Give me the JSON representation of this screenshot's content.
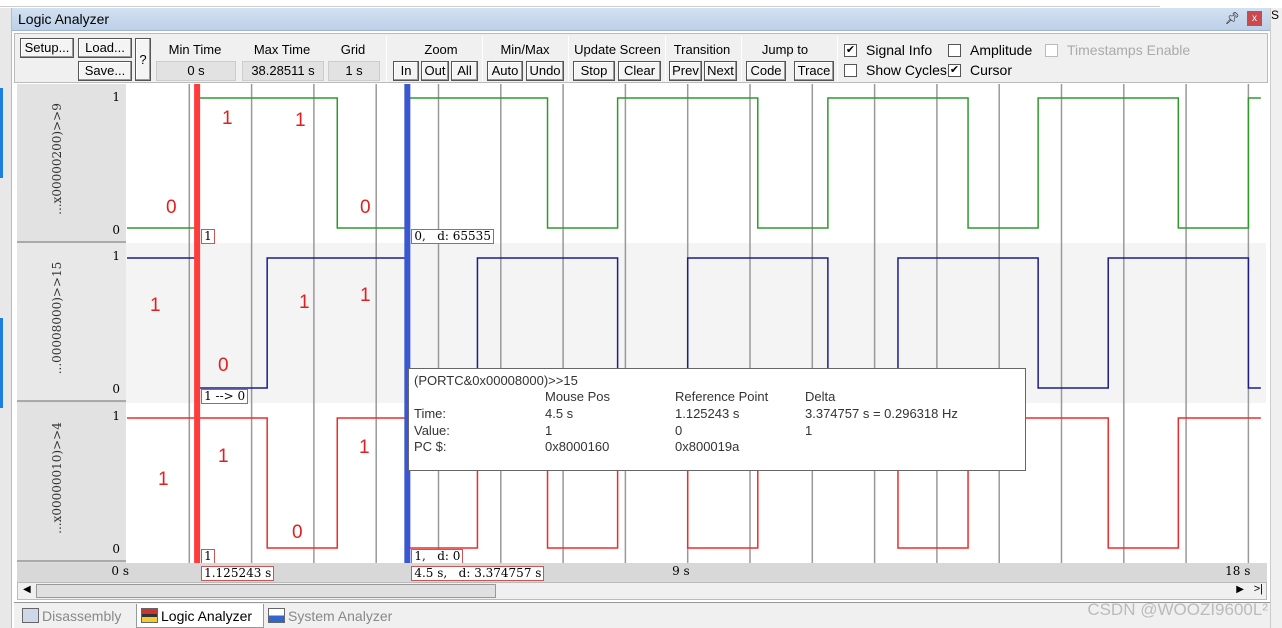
{
  "window": {
    "title": "Logic Analyzer",
    "pin_icon": "pin-icon",
    "close_label": "x",
    "right_edge_letter": "S"
  },
  "toolbar": {
    "setup": "Setup...",
    "load": "Load...",
    "save": "Save...",
    "help": "?",
    "min_time_label": "Min Time",
    "min_time": "0 s",
    "max_time_label": "Max Time",
    "max_time": "38.28511 s",
    "grid_label": "Grid",
    "grid": "1 s",
    "zoom_label": "Zoom",
    "zoom_in": "In",
    "zoom_out": "Out",
    "zoom_all": "All",
    "minmax_label": "Min/Max",
    "auto": "Auto",
    "undo": "Undo",
    "update_label": "Update Screen",
    "stop": "Stop",
    "clear": "Clear",
    "transition_label": "Transition",
    "prev": "Prev",
    "next": "Next",
    "jump_label": "Jump to",
    "code": "Code",
    "trace": "Trace",
    "options": [
      {
        "label": "Signal Info",
        "checked": true,
        "enabled": true
      },
      {
        "label": "Amplitude",
        "checked": false,
        "enabled": true
      },
      {
        "label": "Timestamps Enable",
        "checked": false,
        "enabled": false
      },
      {
        "label": "Show Cycles",
        "checked": false,
        "enabled": true
      },
      {
        "label": "Cursor",
        "checked": true,
        "enabled": true
      }
    ]
  },
  "signals": [
    {
      "name": "...x00000200)>>9",
      "color": "#2e9a2e",
      "max": "1",
      "min": "0",
      "steps": [
        [
          0,
          0
        ],
        [
          1.125,
          1
        ],
        [
          3.375,
          0
        ],
        [
          4.5,
          1
        ],
        [
          6.75,
          0
        ],
        [
          7.875,
          1
        ],
        [
          10.125,
          0
        ],
        [
          11.25,
          1
        ],
        [
          13.5,
          0
        ],
        [
          14.625,
          1
        ],
        [
          16.875,
          0
        ],
        [
          18.0,
          1
        ]
      ]
    },
    {
      "name": "...00008000)>>15",
      "color": "#1c1c8c",
      "max": "1",
      "min": "0",
      "steps": [
        [
          0,
          1
        ],
        [
          1.125,
          0
        ],
        [
          2.25,
          1
        ],
        [
          4.5,
          0
        ],
        [
          5.625,
          1
        ],
        [
          7.875,
          0
        ],
        [
          9.0,
          1
        ],
        [
          11.25,
          0
        ],
        [
          12.375,
          1
        ],
        [
          14.625,
          0
        ],
        [
          15.75,
          1
        ],
        [
          18.0,
          0
        ]
      ]
    },
    {
      "name": "...x00000010)>>4",
      "color": "#f02a2a",
      "max": "1",
      "min": "0",
      "steps": [
        [
          0,
          1
        ],
        [
          2.25,
          0
        ],
        [
          3.375,
          1
        ],
        [
          4.5,
          0
        ],
        [
          5.625,
          1
        ],
        [
          6.75,
          0
        ],
        [
          7.875,
          1
        ],
        [
          9.0,
          0
        ],
        [
          10.125,
          1
        ],
        [
          12.375,
          0
        ],
        [
          13.5,
          1
        ],
        [
          15.75,
          0
        ],
        [
          16.875,
          1
        ]
      ]
    }
  ],
  "time_axis": {
    "end": 18.2,
    "grid_step": 1,
    "labels": [
      "0 s",
      "9 s",
      "18 s"
    ],
    "label_times": [
      0,
      9,
      18
    ]
  },
  "cursors": {
    "reference": {
      "time": 1.125243,
      "color": "#ff3b3b",
      "signal_values": [
        "1",
        "1 --> 0",
        "1"
      ],
      "time_label": "1.125243 s"
    },
    "mouse": {
      "time": 4.5,
      "color": "#3a56d0",
      "signal_values": [
        "0,   d: 65535",
        "",
        "1,   d: 0"
      ],
      "time_label": "4.5 s,   d: 3.374757 s"
    }
  },
  "tooltip": {
    "signal": "(PORTC&0x00008000)>>15",
    "headers": [
      "Mouse Pos",
      "Reference Point",
      "Delta"
    ],
    "rows": [
      {
        "label": "Time:",
        "values": [
          "4.5 s",
          "1.125243 s",
          "3.374757 s = 0.296318 Hz"
        ]
      },
      {
        "label": "Value:",
        "values": [
          "1",
          "0",
          "1"
        ]
      },
      {
        "label": "PC $:",
        "values": [
          "0x8000160",
          "0x800019a",
          ""
        ]
      }
    ]
  },
  "annotations": [
    "0",
    "1",
    "1",
    "0",
    "1",
    "0",
    "1",
    "1",
    "1",
    "1",
    "0",
    "1"
  ],
  "tabs": [
    {
      "label": "Disassembly",
      "icon": "disassembly-icon",
      "active": false
    },
    {
      "label": "Logic Analyzer",
      "icon": "logic-analyzer-icon",
      "active": true
    },
    {
      "label": "System Analyzer",
      "icon": "system-analyzer-icon",
      "active": false
    }
  ],
  "watermark": "CSDN @WOOZI9600L²"
}
